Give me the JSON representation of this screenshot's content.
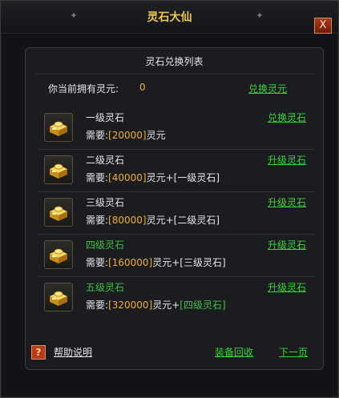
{
  "window": {
    "title": "灵石大仙",
    "close_glyph": "X"
  },
  "panel": {
    "title": "灵石兑换列表",
    "balance_label": "你当前拥有灵元:",
    "balance_value": "0",
    "exchange_link": "兑换灵元"
  },
  "items": [
    {
      "name": "一级灵石",
      "req_label": "需要:",
      "req_amount": "[20000]",
      "req_unit": "灵元",
      "req_plus": "",
      "req_item": "",
      "action": "兑换灵石",
      "name_color": "white"
    },
    {
      "name": "二级灵石",
      "req_label": "需要:",
      "req_amount": "[40000]",
      "req_unit": "灵元",
      "req_plus": "+",
      "req_item": "[一级灵石]",
      "action": "升级灵石",
      "name_color": "white"
    },
    {
      "name": "三级灵石",
      "req_label": "需要:",
      "req_amount": "[80000]",
      "req_unit": "灵元",
      "req_plus": "+",
      "req_item": "[二级灵石]",
      "action": "升级灵石",
      "name_color": "white"
    },
    {
      "name": "四级灵石",
      "req_label": "需要:",
      "req_amount": "[160000]",
      "req_unit": "灵元",
      "req_plus": "+",
      "req_item": "[三级灵石]",
      "action": "升级灵石",
      "name_color": "green"
    },
    {
      "name": "五级灵石",
      "req_label": "需要:",
      "req_amount": "[320000]",
      "req_unit": "灵元",
      "req_plus": "+",
      "req_item": "[四级灵石]",
      "action": "升级灵石",
      "name_color": "green"
    }
  ],
  "footer": {
    "help_glyph": "?",
    "help_label": "帮助说明",
    "recycle_label": "装备回收",
    "next_label": "下一页"
  },
  "icon": "gold-ingot-chest-icon",
  "colors": {
    "title_gold": "#f0c94a",
    "link_green": "#39d43a",
    "amount_orange": "#f0b030",
    "panel_bg": "#1b1c20",
    "window_bg": "#121316"
  }
}
